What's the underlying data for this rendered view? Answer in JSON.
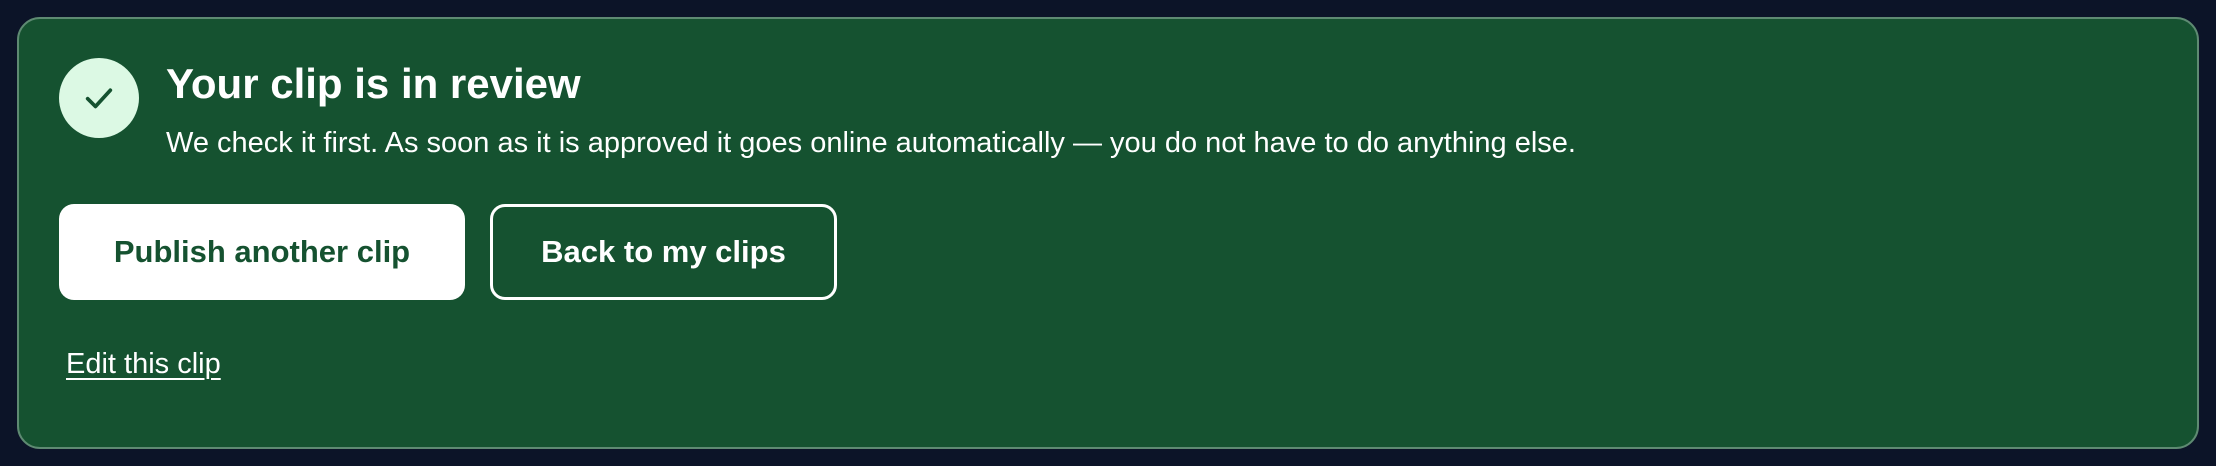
{
  "notice": {
    "title": "Your clip is in review",
    "message": "We check it first. As soon as it is approved it goes online automatically — you do not have to do anything else.",
    "icon": "check-icon"
  },
  "actions": {
    "publish_label": "Publish another clip",
    "back_label": "Back to my clips",
    "edit_label": "Edit this clip"
  },
  "colors": {
    "page_background": "#0c1428",
    "card_background": "#155230",
    "card_border": "#5e8a72",
    "icon_background": "#dcf9e4",
    "check": "#155230",
    "text": "#ffffff"
  }
}
